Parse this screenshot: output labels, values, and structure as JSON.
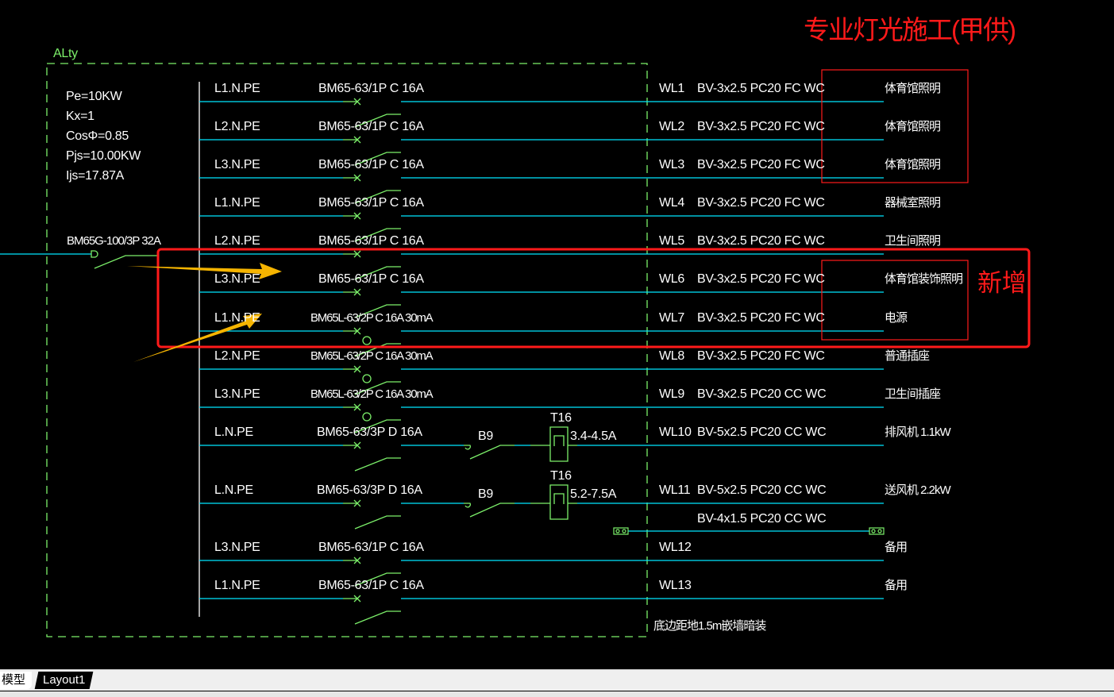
{
  "annotation": {
    "title": "专业灯光施工(甲供)",
    "new_label": "新增",
    "colors": {
      "annotation": "#ff1a1a",
      "arrow": "#f5b400"
    }
  },
  "panel": {
    "name": "ALty",
    "params": [
      "Pe=10KW",
      "Kx=1",
      "CosΦ=0.85",
      "Pjs=10.00KW",
      "Ijs=17.87A"
    ],
    "main_breaker": "BM65G-100/3P 32A",
    "install_note": "底边距地1.5m嵌墙暗装"
  },
  "circuits": [
    {
      "phase": "L1.N.PE",
      "breaker": "BM65-63/1P C 16A",
      "id": "WL1",
      "cable": "BV-3x2.5 PC20 FC WC",
      "load": "体育馆照明"
    },
    {
      "phase": "L2.N.PE",
      "breaker": "BM65-63/1P C 16A",
      "id": "WL2",
      "cable": "BV-3x2.5 PC20 FC WC",
      "load": "体育馆照明"
    },
    {
      "phase": "L3.N.PE",
      "breaker": "BM65-63/1P C 16A",
      "id": "WL3",
      "cable": "BV-3x2.5 PC20 FC WC",
      "load": "体育馆照明"
    },
    {
      "phase": "L1.N.PE",
      "breaker": "BM65-63/1P C 16A",
      "id": "WL4",
      "cable": "BV-3x2.5 PC20 FC WC",
      "load": "器械室照明"
    },
    {
      "phase": "L2.N.PE",
      "breaker": "BM65-63/1P C 16A",
      "id": "WL5",
      "cable": "BV-3x2.5 PC20 FC WC",
      "load": "卫生间照明"
    },
    {
      "phase": "L3.N.PE",
      "breaker": "BM65-63/1P C 16A",
      "id": "WL6",
      "cable": "BV-3x2.5 PC20 FC WC",
      "load": "体育馆装饰照明"
    },
    {
      "phase": "L1.N.PE",
      "breaker": "BM65L-63/2P C 16A 30mA",
      "id": "WL7",
      "cable": "BV-3x2.5 PC20 FC WC",
      "load": "电源"
    },
    {
      "phase": "L2.N.PE",
      "breaker": "BM65L-63/2P C 16A 30mA",
      "id": "WL8",
      "cable": "BV-3x2.5 PC20 FC WC",
      "load": "普通插座"
    },
    {
      "phase": "L3.N.PE",
      "breaker": "BM65L-63/2P C 16A 30mA",
      "id": "WL9",
      "cable": "BV-3x2.5 PC20 CC WC",
      "load": "卫生间插座"
    },
    {
      "phase": "L.N.PE",
      "breaker": "BM65-63/3P D 16A",
      "id": "WL10",
      "cable": "BV-5x2.5 PC20 CC WC",
      "load": "排风机 1.1kW",
      "contactor": "B9",
      "relay": "T16",
      "relay_range": "3.4-4.5A"
    },
    {
      "phase": "L.N.PE",
      "breaker": "BM65-63/3P D 16A",
      "id": "WL11",
      "cable": "BV-5x2.5 PC20 CC WC",
      "load": "送风机 2.2kW",
      "contactor": "B9",
      "relay": "T16",
      "relay_range": "5.2-7.5A"
    },
    {
      "phase": "L3.N.PE",
      "breaker": "BM65-63/1P C 16A",
      "id": "WL12",
      "cable": "",
      "load": "备用"
    },
    {
      "phase": "L1.N.PE",
      "breaker": "BM65-63/1P C 16A",
      "id": "WL13",
      "cable": "",
      "load": "备用"
    }
  ],
  "control_cable": "BV-4x1.5 PC20 CC WC",
  "tabs": [
    {
      "label": "模型",
      "active": false
    },
    {
      "label": "Layout1",
      "active": true
    }
  ]
}
